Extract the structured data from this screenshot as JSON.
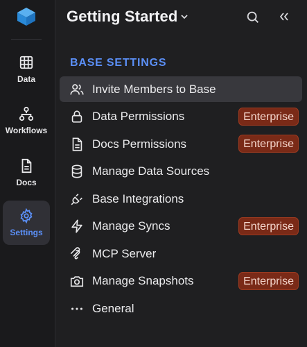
{
  "rail": {
    "items": [
      {
        "label": "Data",
        "icon": "table-icon"
      },
      {
        "label": "Workflows",
        "icon": "workflow-icon"
      },
      {
        "label": "Docs",
        "icon": "document-icon"
      },
      {
        "label": "Settings",
        "icon": "gear-icon",
        "active": true
      }
    ]
  },
  "header": {
    "title": "Getting Started"
  },
  "section": {
    "title": "BASE SETTINGS"
  },
  "menu": {
    "items": [
      {
        "label": "Invite Members to Base",
        "icon": "users-icon",
        "active": true
      },
      {
        "label": "Data Permissions",
        "icon": "lock-icon",
        "badge": "Enterprise"
      },
      {
        "label": "Docs Permissions",
        "icon": "document-icon",
        "badge": "Enterprise"
      },
      {
        "label": "Manage Data Sources",
        "icon": "database-icon"
      },
      {
        "label": "Base Integrations",
        "icon": "plug-icon"
      },
      {
        "label": "Manage Syncs",
        "icon": "lightning-icon",
        "badge": "Enterprise"
      },
      {
        "label": "MCP Server",
        "icon": "mcp-icon"
      },
      {
        "label": "Manage Snapshots",
        "icon": "camera-icon",
        "badge": "Enterprise"
      },
      {
        "label": "General",
        "icon": "more-icon"
      }
    ]
  },
  "colors": {
    "accent": "#5b8ff6",
    "badge_bg": "#7a2a17",
    "background": "#1f1f21"
  }
}
